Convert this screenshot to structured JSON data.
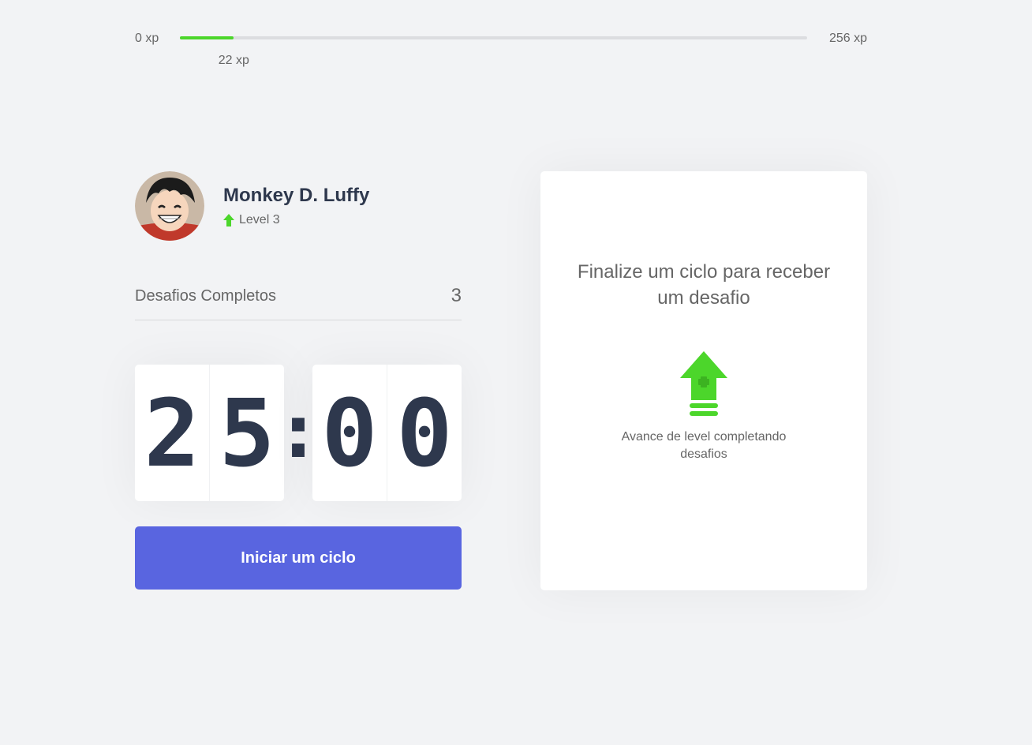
{
  "xp": {
    "min_label": "0 xp",
    "max_label": "256 xp",
    "current_label": "22 xp",
    "current": 22,
    "max": 256,
    "fill_color": "#4cd62b"
  },
  "profile": {
    "name": "Monkey D. Luffy",
    "level_label": "Level 3",
    "level_icon": "level-up-arrow-icon"
  },
  "stats": {
    "completed_label": "Desafios Completos",
    "completed_value": "3"
  },
  "countdown": {
    "minute_left": "2",
    "minute_right": "5",
    "separator": ":",
    "second_left": "0",
    "second_right": "0"
  },
  "actions": {
    "start_label": "Iniciar um ciclo",
    "start_color": "#5965e0"
  },
  "challenge_card": {
    "title": "Finalize um ciclo para receber um desafio",
    "icon": "level-up-icon",
    "description": "Avance de level completando desafios"
  }
}
